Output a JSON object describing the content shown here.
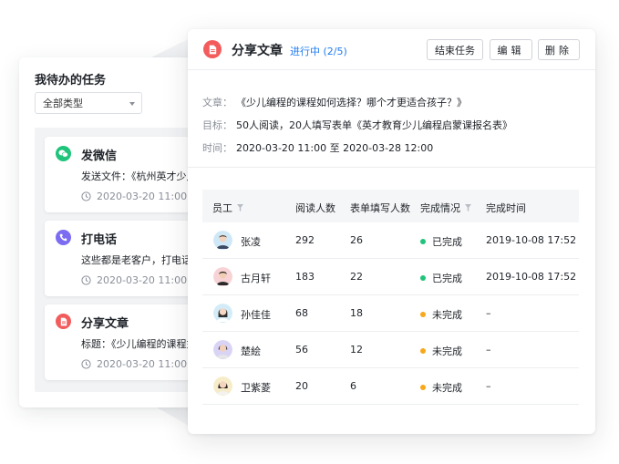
{
  "task_panel": {
    "title": "我待办的任务",
    "type_select": "全部类型",
    "tasks": [
      {
        "icon": "wechat-icon",
        "color": "#1fc47a",
        "title": "发微信",
        "desc": "发送文件：《杭州英才少儿",
        "time": "2020-03-20 11:00 至"
      },
      {
        "icon": "phone-icon",
        "color": "#7b6cf2",
        "title": "打电话",
        "desc": "这些都是老客户，打电话河",
        "time": "2020-03-20 11:00 至"
      },
      {
        "icon": "document-icon",
        "color": "#f25c5c",
        "title": "分享文章",
        "desc": "标题：《少儿编程的课程如",
        "time": "2020-03-20 11:00 至"
      }
    ]
  },
  "detail": {
    "title": "分享文章",
    "status": "进行中 (2/5)",
    "status_color": "#1f7cf0",
    "buttons": {
      "end": "结束任务",
      "edit": "编辑",
      "delete": "删除"
    },
    "article": {
      "label": "文章：",
      "value": "《少儿编程的课程如何选择？哪个才更适合孩子？》"
    },
    "goal": {
      "label": "目标：",
      "value": "50人阅读，20人填写表单《英才教育少儿编程启蒙课报名表》"
    },
    "time": {
      "label": "时间：",
      "value": "2020-03-20 11:00 至 2020-03-28 12:00"
    }
  },
  "table": {
    "headers": {
      "employee": "员工",
      "reads": "阅读人数",
      "forms": "表单填写人数",
      "status": "完成情况",
      "done_time": "完成时间"
    },
    "rows": [
      {
        "name": "张凌",
        "reads": "292",
        "forms": "26",
        "status": "已完成",
        "status_color": "#1fc47a",
        "done_time": "2019-10-08   17:52"
      },
      {
        "name": "古月轩",
        "reads": "183",
        "forms": "22",
        "status": "已完成",
        "status_color": "#1fc47a",
        "done_time": "2019-10-08   17:52"
      },
      {
        "name": "孙佳佳",
        "reads": "68",
        "forms": "18",
        "status": "未完成",
        "status_color": "#f7a81b",
        "done_time": "–"
      },
      {
        "name": "楚絵",
        "reads": "56",
        "forms": "12",
        "status": "未完成",
        "status_color": "#f7a81b",
        "done_time": "–"
      },
      {
        "name": "卫紫菱",
        "reads": "20",
        "forms": "6",
        "status": "未完成",
        "status_color": "#f7a81b",
        "done_time": "–"
      }
    ]
  }
}
